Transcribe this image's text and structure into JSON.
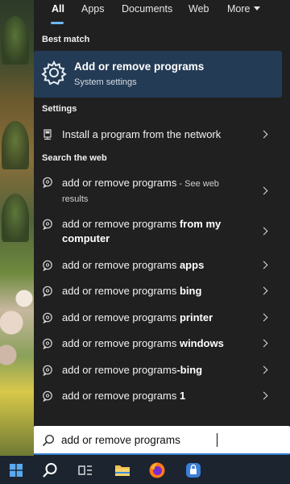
{
  "tabs": [
    {
      "label": "All"
    },
    {
      "label": "Apps"
    },
    {
      "label": "Documents"
    },
    {
      "label": "Web"
    },
    {
      "label": "More"
    }
  ],
  "sections": {
    "best_match": "Best match",
    "settings": "Settings",
    "search_web": "Search the web"
  },
  "best_match": {
    "title": "Add or remove programs",
    "subtitle": "System settings",
    "icon": "gear-icon"
  },
  "settings_items": [
    {
      "label": "Install a program from the network",
      "icon": "network-program-icon"
    }
  ],
  "web_results": [
    {
      "query": "add or remove programs",
      "suffix": "",
      "extra": " - See web results"
    },
    {
      "query": "add or remove programs ",
      "suffix": "from my computer",
      "extra": ""
    },
    {
      "query": "add or remove programs ",
      "suffix": "apps",
      "extra": ""
    },
    {
      "query": "add or remove programs ",
      "suffix": "bing",
      "extra": ""
    },
    {
      "query": "add or remove programs ",
      "suffix": "printer",
      "extra": ""
    },
    {
      "query": "add or remove programs ",
      "suffix": "windows",
      "extra": ""
    },
    {
      "query": "add or remove programs",
      "suffix": "-bing",
      "extra": ""
    },
    {
      "query": "add or remove programs ",
      "suffix": "1",
      "extra": ""
    }
  ],
  "search": {
    "value": "add or remove programs",
    "icon": "search-icon"
  },
  "taskbar": {
    "items": [
      "windows-start-icon",
      "search-icon",
      "task-view-icon",
      "file-explorer-icon",
      "firefox-icon",
      "security-app-icon"
    ]
  },
  "colors": {
    "accent": "#6cb8f6",
    "best_match_bg": "#243b55",
    "panel_bg": "#202020",
    "taskbar_bg": "#1c2430"
  }
}
